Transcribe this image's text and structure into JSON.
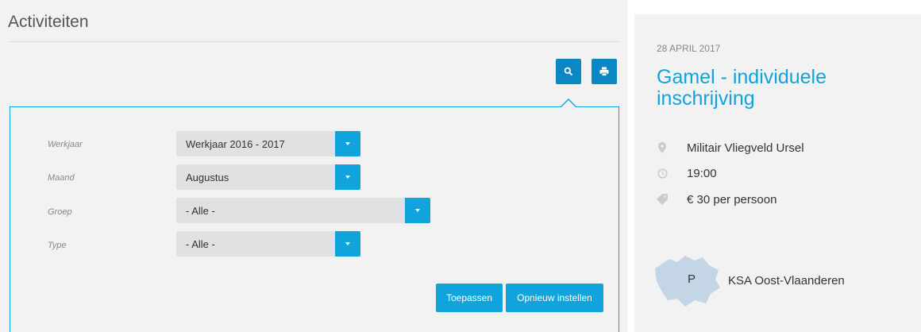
{
  "page": {
    "title": "Activiteiten"
  },
  "toolbar": {
    "search_icon": "search-icon",
    "print_icon": "print-icon",
    "accent_color": "#0b88c4"
  },
  "filters": {
    "fields": [
      {
        "label": "Werkjaar",
        "value": "Werkjaar 2016 - 2017"
      },
      {
        "label": "Maand",
        "value": "Augustus"
      },
      {
        "label": "Groep",
        "value": "- Alle -"
      },
      {
        "label": "Type",
        "value": "- Alle -"
      }
    ],
    "apply_label": "Toepassen",
    "reset_label": "Opnieuw instellen",
    "accent_color": "#11a3dc"
  },
  "event": {
    "date": "28 APRIL 2017",
    "title": "Gamel - individuele inschrijving",
    "location": "Militair Vliegveld Ursel",
    "time": "19:00",
    "price": "€ 30 per persoon",
    "organizer_letter": "P",
    "organizer": "KSA Oost-Vlaanderen",
    "title_color": "#11a3dc"
  }
}
